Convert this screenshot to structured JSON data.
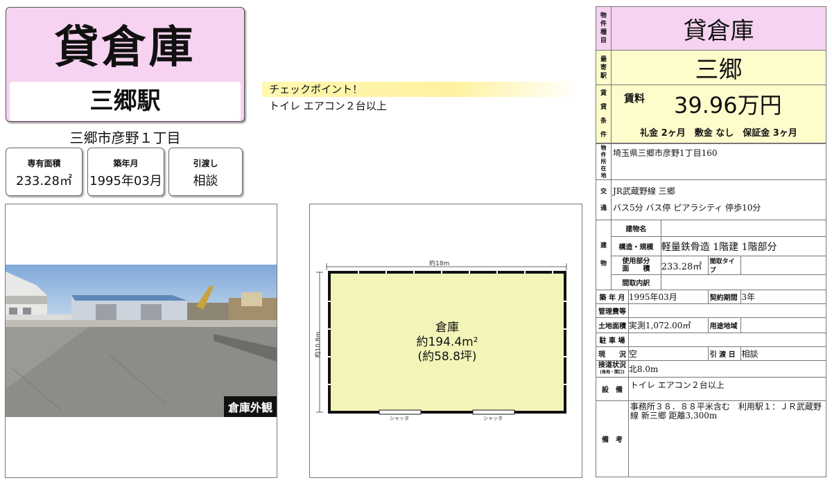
{
  "header": {
    "title": "貸倉庫",
    "station": "三郷駅",
    "address": "三郷市彦野１丁目"
  },
  "specs": [
    {
      "label": "専有面積",
      "value": "233.28㎡"
    },
    {
      "label": "築年月",
      "value": "1995年03月"
    },
    {
      "label": "引渡し",
      "value": "相談"
    }
  ],
  "checkpoint": {
    "title": "チェックポイント！",
    "body": "トイレ エアコン２台以上"
  },
  "photo": {
    "caption": "倉庫外観"
  },
  "floorplan": {
    "width_label": "約18m",
    "height_label": "約10.8m",
    "room_name": "倉庫",
    "area_m2": "約194.4m²",
    "area_tsubo": "(約58.8坪)",
    "shutter_label_1": "シャッタ",
    "shutter_label_2": "シャッタ"
  },
  "table": {
    "type_label": "物件種目",
    "type_value": "貸倉庫",
    "station_label": "最寄駅",
    "station_value": "三郷",
    "terms_label": "賃貸条件",
    "rent_label": "賃料",
    "rent_value": "39.96万円",
    "deposit_text": "礼金 2ヶ月　敷金 なし　保証金 3ヶ月",
    "location_label": "物件所在地",
    "location_value": "埼玉県三郷市彦野1丁目160",
    "traffic_label": "交通",
    "traffic_line1": "JR武蔵野線 三郷",
    "traffic_line2": "バス5分 バス停 ピアラシティ 停歩10分",
    "building_label": "建物",
    "building_name_label": "建物名",
    "building_name_value": "",
    "structure_label": "構造・規模",
    "structure_value": "軽量鉄骨造 1階建 1階部分",
    "usage_area_label_1": "使用部分",
    "usage_area_label_2": "面　　積",
    "usage_area_value": "233.28㎡",
    "layout_type_label": "間取タイプ",
    "layout_type_value": "",
    "layout_detail_label": "間取内訳",
    "layout_detail_value": "",
    "built_label": "築 年 月",
    "built_value": "1995年03月",
    "contract_label": "契約期間",
    "contract_value": "3年",
    "mgmt_label": "管理費等",
    "mgmt_value": "",
    "land_label": "土地面積",
    "land_value": "実測1,072.00㎡",
    "zoning_label": "用途地域",
    "zoning_value": "",
    "parking_label": "駐 車 場",
    "parking_value": "",
    "status_label": "現　　況",
    "status_value": "空",
    "handover_label": "引 渡 日",
    "handover_value": "相談",
    "road_label": "接道状況",
    "road_sub": "(角地・間口)",
    "road_value": "北8.0m",
    "equipment_label": "設　備",
    "equipment_value": "トイレ エアコン２台以上",
    "remarks_label": "備　考",
    "remarks_value": "事務所３８．８８平米含む　利用駅１：ＪＲ武蔵野線 新三郷 距離3,300m"
  }
}
